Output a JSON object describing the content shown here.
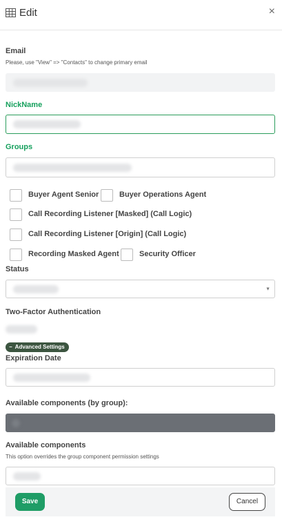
{
  "header": {
    "title": "Edit",
    "icon": "table-icon",
    "close_glyph": "×"
  },
  "email": {
    "label": "Email",
    "hint": "Please, use \"View\" => \"Contacts\" to change primary email"
  },
  "nickname": {
    "label": "NickName"
  },
  "groups": {
    "label": "Groups",
    "checkboxes": [
      "Buyer Agent Senior",
      "Buyer Operations Agent",
      "Call Recording Listener [Masked] (Call Logic)",
      "Call Recording Listener [Origin] (Call Logic)",
      "Recording Masked Agent",
      "Security Officer"
    ]
  },
  "status": {
    "label": "Status"
  },
  "two_factor": {
    "label": "Two-Factor Authentication"
  },
  "advanced": {
    "label": "Advanced Settings",
    "glyph": "−"
  },
  "expiration": {
    "label": "Expiration Date"
  },
  "available_by_group": {
    "label": "Available components (by group):"
  },
  "available": {
    "label": "Available components",
    "hint": "This option overrides the group component permission settings"
  },
  "footer": {
    "save_label": "Save",
    "cancel_label": "Cancel"
  },
  "colors": {
    "accent_green": "#16a05d",
    "save_button": "#1f9d66",
    "advanced_pill": "#3c5540",
    "disabled_field": "#6b6f75"
  }
}
